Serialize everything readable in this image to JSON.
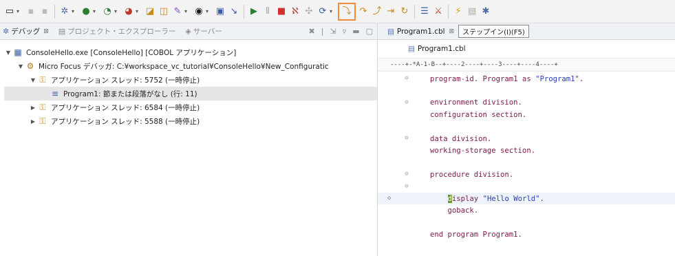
{
  "toolbar": {
    "icons": [
      "new-icon",
      "save-icon",
      "save-all-icon",
      "debug-config-icon",
      "run-icon",
      "skip-breakpoints-icon",
      "terminate-icon",
      "open-perspective-icon",
      "search-icon",
      "select-icon",
      "resume-icon",
      "suspend-icon",
      "stop-icon",
      "disconnect-icon",
      "step-into-icon",
      "step-over-icon",
      "step-return-icon",
      "drop-to-frame-icon",
      "use-step-filters-icon",
      "compare-icon",
      "animate-icon",
      "perspective-icon",
      "debug-perspective-icon"
    ],
    "highlighted_icon": "step-into-icon",
    "highlight_color": "#f08b3c"
  },
  "debug_view": {
    "tabs": [
      {
        "label": "デバッグ",
        "close": "⊠",
        "active": true
      },
      {
        "label": "プロジェクト・エクスプローラー",
        "active": false
      },
      {
        "label": "サーバー",
        "active": false
      }
    ],
    "tree": [
      {
        "text": "ConsoleHello.exe [ConsoleHello] [COBOL アプリケーション]",
        "expanded": true
      },
      {
        "text": "Micro Focus デバッガ: C:¥workspace_vc_tutorial¥ConsoleHello¥New_Configuratic",
        "expanded": true
      },
      {
        "text": "アプリケーション スレッド: 5752 (一時停止)",
        "expanded": true
      },
      {
        "text": "Program1: 節または段落がなし (行: 11)",
        "selected": true
      },
      {
        "text": "アプリケーション スレッド: 6584 (一時停止)",
        "expanded": false
      },
      {
        "text": "アプリケーション スレッド: 5588 (一時停止)",
        "expanded": false
      }
    ]
  },
  "editor": {
    "tab_label": "Program1.cbl",
    "tab_close": "⊠",
    "tooltip": "ステップイン(I)(F5)",
    "breadcrumb": "Program1.cbl",
    "ruler": "----+-*A-1-B--+----2----+----3----+----4----+",
    "code_lines": [
      {
        "text": "program-id. Program1 as ",
        "string": "\"Program1\"",
        "tail": ".",
        "fold": true
      },
      {
        "text": "",
        "fold": false
      },
      {
        "text": "environment division.",
        "fold": true
      },
      {
        "text": "configuration section.",
        "fold": false
      },
      {
        "text": "",
        "fold": false
      },
      {
        "text": "data division.",
        "fold": true
      },
      {
        "text": "working-storage section.",
        "fold": false
      },
      {
        "text": "",
        "fold": false
      },
      {
        "text": "procedure division.",
        "fold": true
      },
      {
        "text": "",
        "fold": true
      },
      {
        "text": "    isplay ",
        "cursor_char": "d",
        "string": "\"Hello World\"",
        "tail": ".",
        "current": true
      },
      {
        "text": "    goback.",
        "fold": false
      },
      {
        "text": "",
        "fold": false
      },
      {
        "text": "end program Program1.",
        "fold": false
      }
    ]
  }
}
